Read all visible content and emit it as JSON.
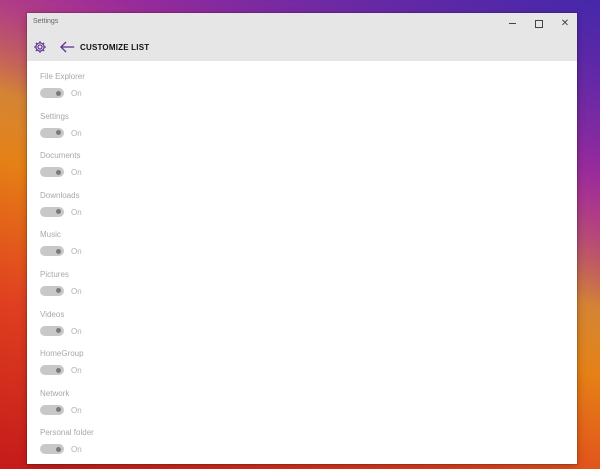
{
  "window": {
    "title": "Settings",
    "controls": {
      "minimize": "minimize-icon",
      "maximize": "maximize-icon",
      "close": "close-icon"
    }
  },
  "header": {
    "title": "CUSTOMIZE LIST",
    "settings_icon": "gear-icon",
    "back_icon": "back-arrow-icon",
    "accent_color": "#5c2d91"
  },
  "toggles": [
    {
      "label": "File Explorer",
      "state": "On"
    },
    {
      "label": "Settings",
      "state": "On"
    },
    {
      "label": "Documents",
      "state": "On"
    },
    {
      "label": "Downloads",
      "state": "On"
    },
    {
      "label": "Music",
      "state": "On"
    },
    {
      "label": "Pictures",
      "state": "On"
    },
    {
      "label": "Videos",
      "state": "On"
    },
    {
      "label": "HomeGroup",
      "state": "On"
    },
    {
      "label": "Network",
      "state": "On"
    },
    {
      "label": "Personal folder",
      "state": "On"
    }
  ]
}
